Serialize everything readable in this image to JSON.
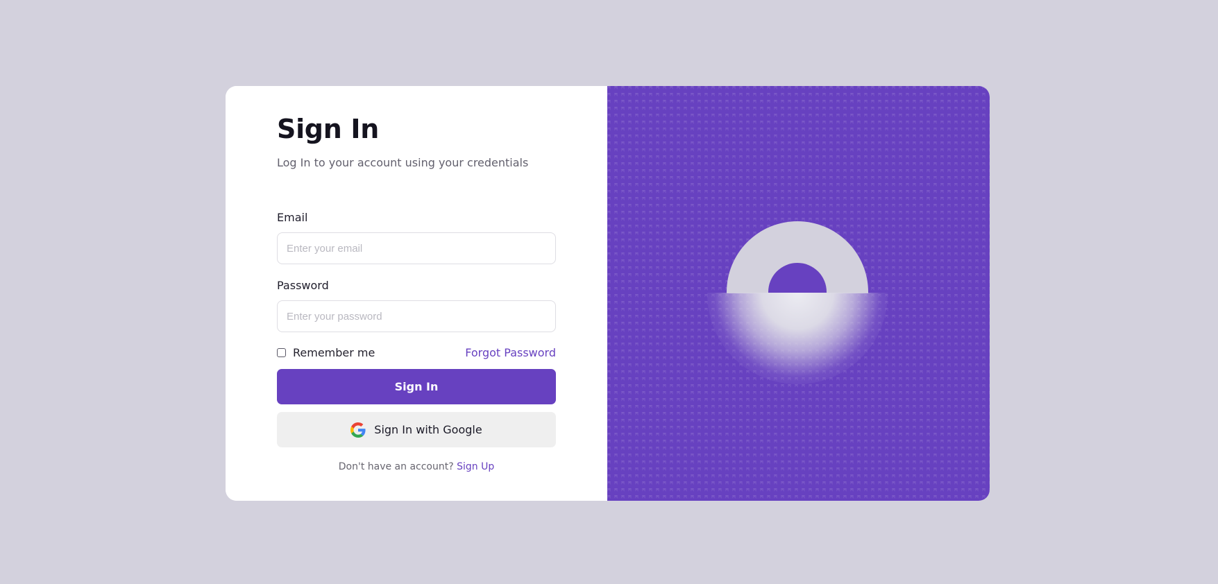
{
  "form": {
    "title": "Sign In",
    "subtitle": "Log In to your account using your credentials",
    "email": {
      "label": "Email",
      "placeholder": "Enter your email",
      "value": ""
    },
    "password": {
      "label": "Password",
      "placeholder": "Enter your password",
      "value": ""
    },
    "remember_label": "Remember me",
    "remember_checked": false,
    "forgot_label": "Forgot Password",
    "signin_label": "Sign In",
    "google_label": "Sign In with Google",
    "signup_prompt": "Don't have an account?",
    "signup_label": "Sign Up"
  },
  "illustration": {
    "icon": "lock-icon"
  },
  "colors": {
    "accent": "#6741c0",
    "page_background": "#d3d1dd",
    "text_dark": "#15141f",
    "text_muted": "#62606d"
  }
}
